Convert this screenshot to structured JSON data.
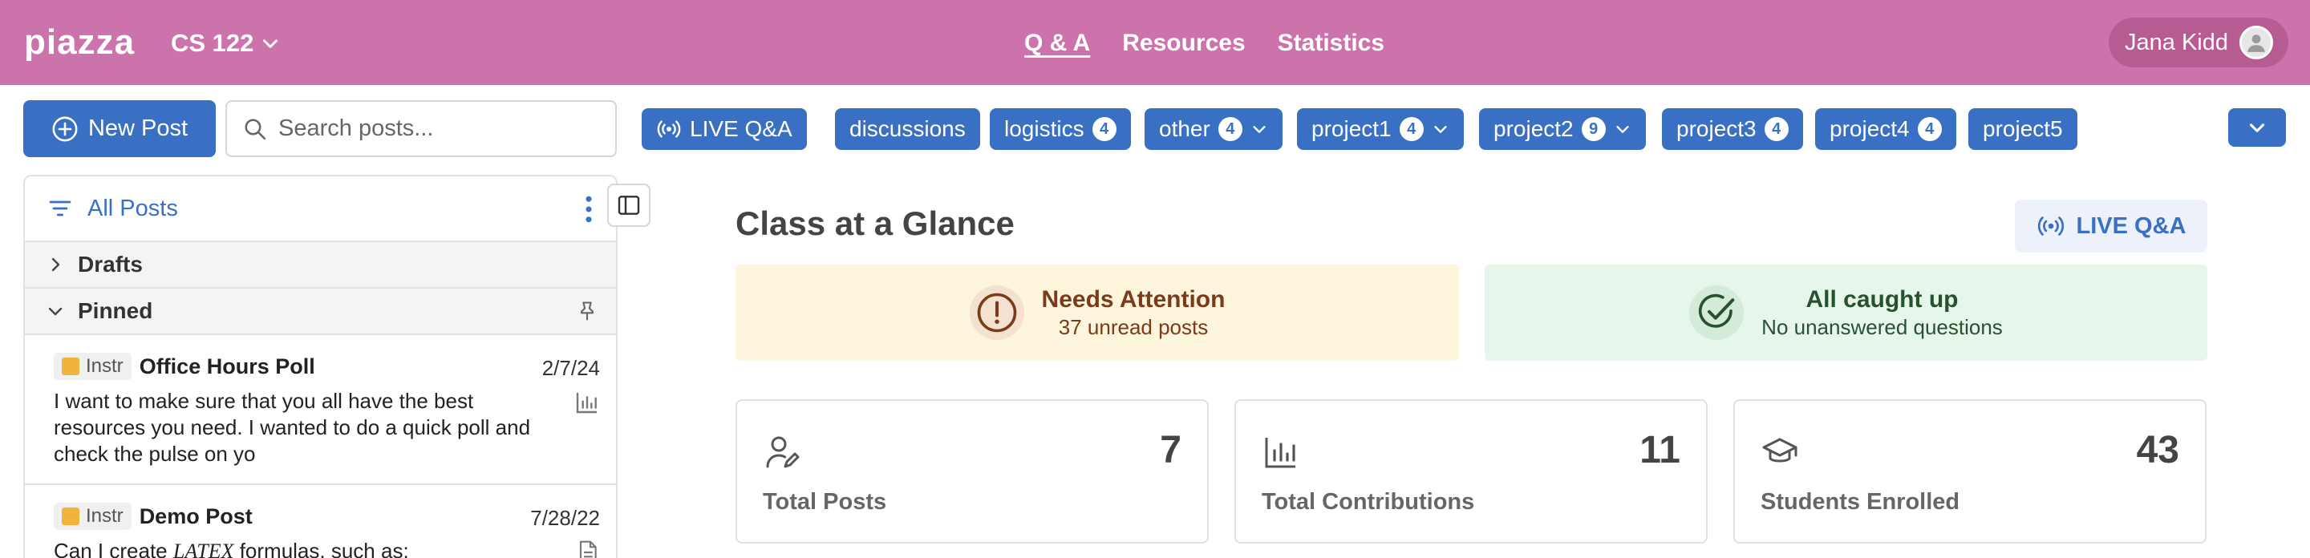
{
  "header": {
    "logo": "piazza",
    "course": "CS 122",
    "nav": [
      "Q & A",
      "Resources",
      "Statistics"
    ],
    "user": "Jana Kidd"
  },
  "toolbar": {
    "new_post": "New Post",
    "search_placeholder": "Search posts...",
    "live": "LIVE Q&A",
    "tags": [
      {
        "label": "discussions"
      },
      {
        "label": "logistics",
        "count": "4"
      },
      {
        "label": "other",
        "count": "4"
      },
      {
        "label": "project1",
        "count": "4"
      },
      {
        "label": "project2",
        "count": "9"
      },
      {
        "label": "project3",
        "count": "4"
      },
      {
        "label": "project4",
        "count": "4"
      },
      {
        "label": "project5"
      }
    ]
  },
  "sidebar": {
    "title": "All Posts",
    "sections": [
      "Drafts",
      "Pinned"
    ],
    "posts": [
      {
        "badge": "Instr",
        "title": "Office Hours Poll",
        "date": "2/7/24",
        "body": "I want to make sure that you all have the best resources you need. I wanted to do a quick poll and check the pulse on yo"
      },
      {
        "badge": "Instr",
        "title": "Demo Post",
        "date": "7/28/22",
        "body_pre": "Can I create ",
        "body_latex": "LATEX",
        "body_post": " formulas, such as:"
      }
    ]
  },
  "main": {
    "title": "Class at a Glance",
    "live": "LIVE Q&A",
    "attention": {
      "title": "Needs Attention",
      "sub": "37 unread posts"
    },
    "caught_up": {
      "title": "All caught up",
      "sub": "No unanswered questions"
    },
    "stats": [
      {
        "value": "7",
        "label": "Total Posts"
      },
      {
        "value": "11",
        "label": "Total Contributions"
      },
      {
        "value": "43",
        "label": "Students Enrolled"
      }
    ]
  },
  "colors": {
    "brand": "#cd73ab",
    "accent": "#3a70c4",
    "attention_bg": "#fdf5dc",
    "ok_bg": "#e6f6ea"
  }
}
